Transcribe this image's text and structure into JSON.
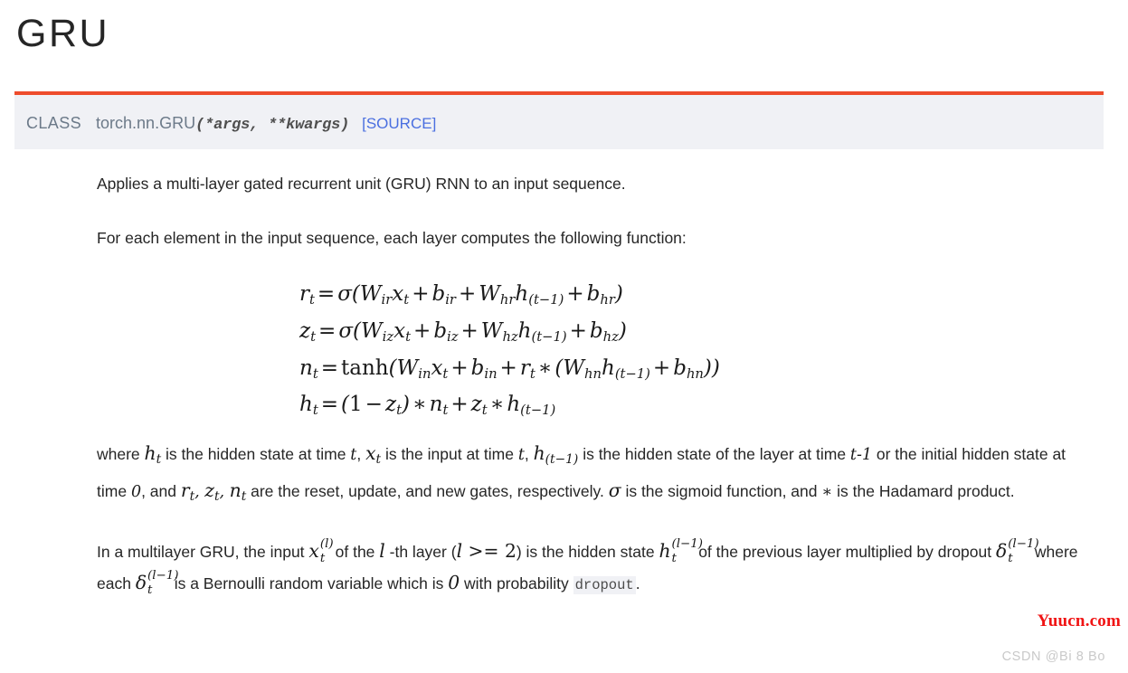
{
  "page": {
    "title": "GRU"
  },
  "signature": {
    "class_keyword": "CLASS",
    "qualified_name": "torch.nn.GRU",
    "args": "(*args, **kwargs)",
    "source_link": "[SOURCE]",
    "accent_color": "#ee4c2c",
    "background_color": "#f0f1f5",
    "link_color": "#4a6fe0"
  },
  "body": {
    "paragraph_1": "Applies a multi-layer gated recurrent unit (GRU) RNN to an input sequence.",
    "paragraph_2": "For each element in the input sequence, each layer computes the following function:",
    "paragraph_3_parts": {
      "a": "where ",
      "b": " is the hidden state at time ",
      "c": ", ",
      "d": " is the input at time ",
      "e": ", ",
      "f": " is the hidden state of the layer at time ",
      "g": "t-1",
      "h": " or the initial hidden state at time ",
      "i": "0",
      "j": ", and ",
      "k": " are the reset, update, and new gates, respectively. ",
      "l": " is the sigmoid function, and ",
      "m": " is the Hadamard product."
    },
    "paragraph_4_parts": {
      "a": "In a multilayer GRU, the input ",
      "b": " of the ",
      "c": " -th layer (",
      "d": ") is the hidden state ",
      "e": " of the previous layer multiplied by dropout ",
      "f": " where each ",
      "g": " is a Bernoulli random variable which is ",
      "h": "0",
      "i": " with probability ",
      "j": "dropout",
      "k": "."
    }
  },
  "equations": {
    "eq1": "r_t = σ(W_ir x_t + b_ir + W_hr h_(t−1) + b_hr)",
    "eq2": "z_t = σ(W_iz x_t + b_iz + W_hz h_(t−1) + b_hz)",
    "eq3": "n_t = tanh(W_in x_t + b_in + r_t * (W_hn h_(t−1) + b_hn))",
    "eq4": "h_t = (1 − z_t) * n_t + z_t * h_(t−1)"
  },
  "watermarks": {
    "yuucn": "Yuucn.com",
    "yuucn_color": "#f01414",
    "csdn": "CSDN @Bi  8  Bo",
    "csdn_color": "#c9c9c9"
  }
}
